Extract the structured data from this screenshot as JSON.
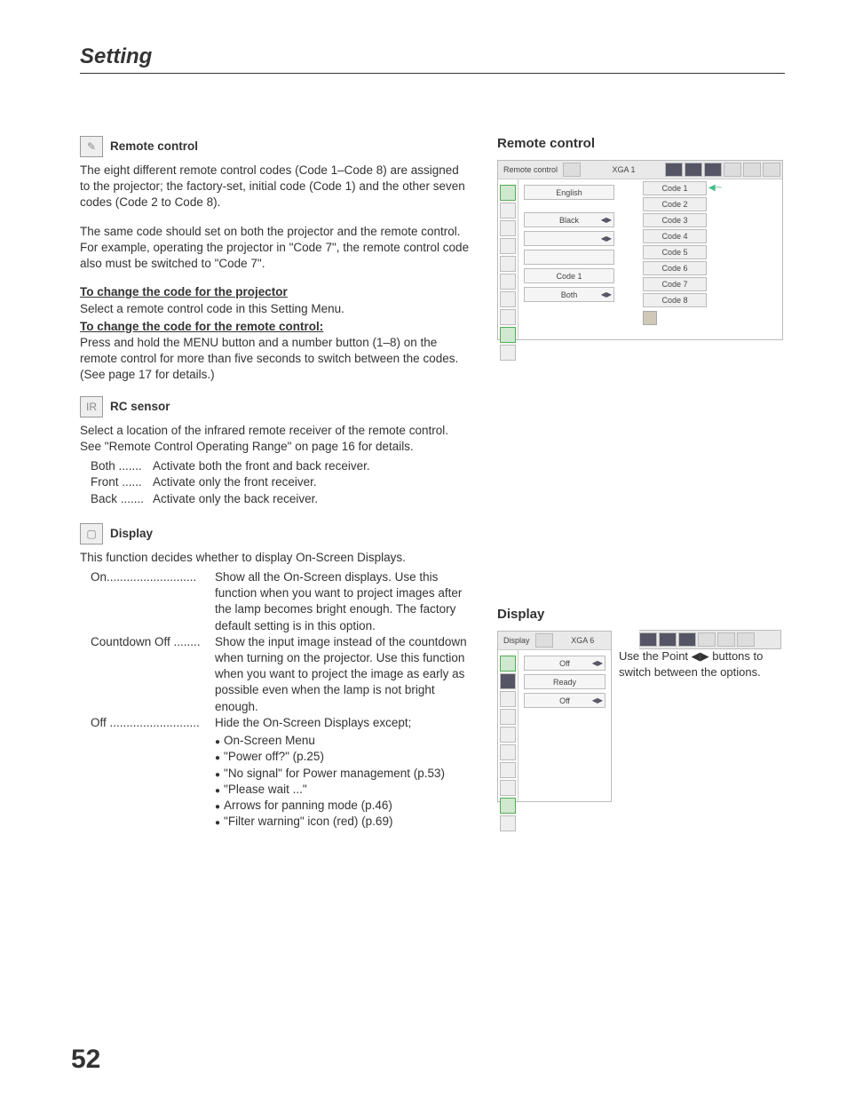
{
  "pageTitle": "Setting",
  "pageNumber": "52",
  "remote": {
    "heading": "Remote control",
    "p1": "The eight different remote control codes (Code 1–Code 8) are assigned to the projector; the factory-set, initial code (Code 1) and the other seven codes (Code 2 to Code 8).",
    "p2": "The same code should set on both the projector and the remote control. For example, operating the projector in \"Code 7\", the remote control code also must be switched to \"Code 7\".",
    "projHead": "To change the code for the projector",
    "projBody": "Select a remote control code in this Setting Menu.",
    "rcHead": "To change the code for the remote control:",
    "rcBody": "Press and hold the MENU button and a number button (1–8) on the remote control for more than five seconds to switch between the codes. (See page 17 for details.)"
  },
  "rcSensor": {
    "heading": "RC sensor",
    "body": "Select a location of the infrared remote receiver of the remote control. See \"Remote Control Operating Range\" on page 16 for details.",
    "opts": [
      {
        "term": "Both .......",
        "desc": "Activate both the front and back receiver."
      },
      {
        "term": "Front ......",
        "desc": "Activate only the front receiver."
      },
      {
        "term": "Back .......",
        "desc": "Activate only the back receiver."
      }
    ]
  },
  "display": {
    "heading": "Display",
    "intro": "This function decides whether to display On-Screen Displays.",
    "opts": [
      {
        "term": "On...........................",
        "desc": "Show all the On-Screen displays. Use this function when you want to project images after the lamp becomes bright enough. The factory default setting is in this option."
      },
      {
        "term": "Countdown Off ........",
        "desc": "Show the input image instead of the countdown when turning on the projector. Use this function when you want to project the image as early as possible even when the lamp is not bright enough."
      },
      {
        "term": "Off ...........................",
        "desc": "Hide the On-Screen Displays except;",
        "list": [
          "On-Screen Menu",
          "\"Power off?\" (p.25)",
          "\"No signal\" for Power management (p.53)",
          "\"Please wait ...\"",
          "Arrows for panning mode (p.46)",
          "\"Filter warning\" icon (red) (p.69)"
        ]
      }
    ]
  },
  "rightRemote": {
    "heading": "Remote control",
    "scrLabel": "Remote control",
    "mode": "XGA 1",
    "values": [
      "English",
      "Black",
      "",
      "",
      "Code 1",
      "Both"
    ],
    "codes": [
      "Code 1",
      "Code 2",
      "Code 3",
      "Code 4",
      "Code 5",
      "Code 6",
      "Code 7",
      "Code 8"
    ]
  },
  "rightDisplay": {
    "heading": "Display",
    "scrLabel": "Display",
    "mode": "XGA 6",
    "values": [
      "Off",
      "Ready",
      "Off"
    ],
    "hint": "Use the Point ◀▶ buttons to switch between the options."
  }
}
